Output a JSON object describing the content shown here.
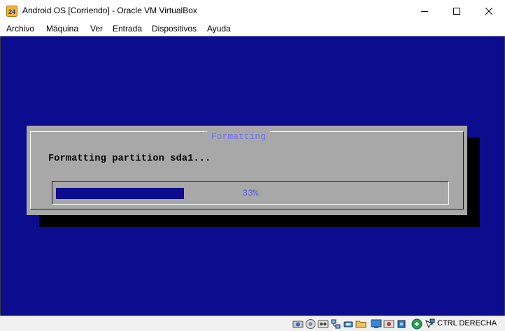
{
  "window": {
    "title": "Android OS [Corriendo] - Oracle VM VirtualBox",
    "icon": "virtualbox-icon",
    "controls": [
      "minimize-icon",
      "maximize-icon",
      "close-icon"
    ]
  },
  "menu": {
    "items": [
      "Archivo",
      "Máquina",
      "Ver",
      "Entrada",
      "Dispositivos",
      "Ayuda"
    ]
  },
  "dialog": {
    "title": "Formatting",
    "message": "Formatting partition sda1...",
    "progress_percent": 33,
    "progress_label": "33%"
  },
  "statusbar": {
    "icons": [
      "hard-disk-icon",
      "optical-drive-icon",
      "audio-icon",
      "network-icon",
      "usb-icon",
      "shared-folders-icon",
      "display-icon",
      "video-capture-icon",
      "cpu-icon",
      "mouse-integration-icon",
      "keyboard-capture-icon"
    ],
    "host_key": "CTRL DERECHA"
  },
  "colors": {
    "guest_background": "#0c0c8e",
    "dialog_background": "#a8a8a8",
    "dialog_title": "#7070f0",
    "progress_fill": "#0c0c8e",
    "progress_text": "#5a5ae8"
  }
}
